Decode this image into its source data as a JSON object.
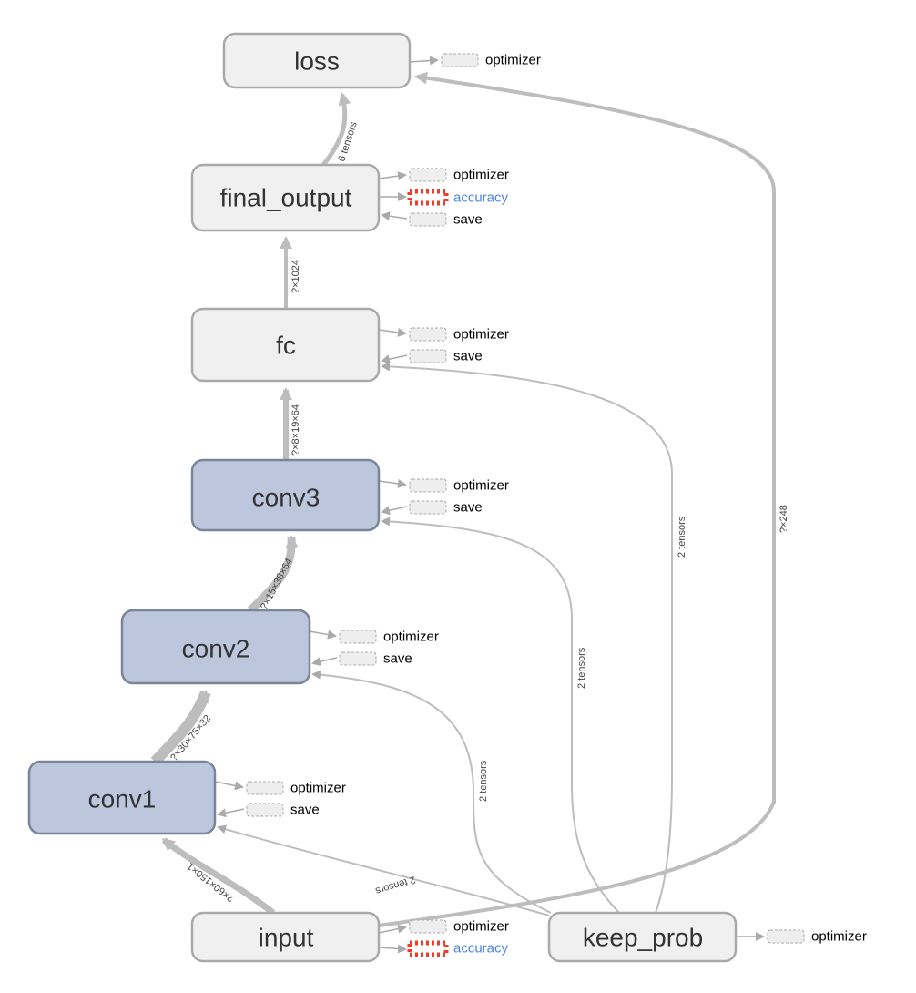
{
  "nodes": {
    "loss": "loss",
    "final_output": "final_output",
    "fc": "fc",
    "conv3": "conv3",
    "conv2": "conv2",
    "conv1": "conv1",
    "input": "input",
    "keep_prob": "keep_prob"
  },
  "aux": {
    "optimizer": "optimizer",
    "accuracy": "accuracy",
    "save": "save"
  },
  "edge_labels": {
    "input_conv1": "?×60×150×1",
    "conv1_conv2": "?×30×75×32",
    "conv2_conv3": "?×15×38×64",
    "conv3_fc": "?×8×19×64",
    "fc_final": "?×1024",
    "final_loss": "6 tensors",
    "keep_conv1": "2 tensors",
    "keep_conv2": "2 tensors",
    "keep_conv3": "2 tensors",
    "keep_fc": "2 tensors",
    "input_loss": "?×248"
  },
  "colors": {
    "op_node": "#f0f0f0",
    "group_node": "#bcc6dc",
    "edge": "#bdbdbd",
    "accuracy_link": "#4a86e8",
    "accuracy_border": "#f03a2a"
  }
}
